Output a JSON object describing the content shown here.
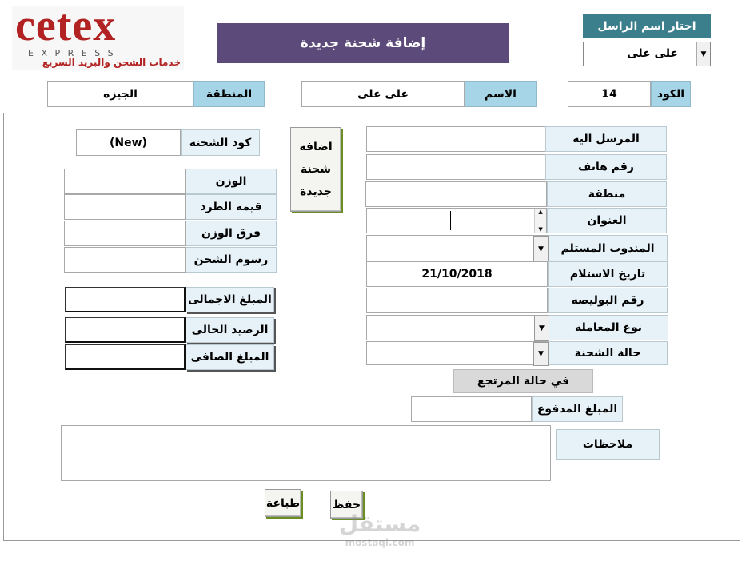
{
  "logo": {
    "brand": "cetex",
    "sub": "E X P R E S S",
    "tagline": "خدمات الشحن والبريد السريع"
  },
  "header": {
    "title": "إضافة شحنة جديدة"
  },
  "sender_select": {
    "label": "اختار اسم الراسل",
    "value": "على على"
  },
  "top_row": {
    "code_label": "الكود",
    "code_value": "14",
    "name_label": "الاسم",
    "name_value": "على على",
    "region_label": "المنطقة",
    "region_value": "الجيزه"
  },
  "form": {
    "recipient_label": "المرسل اليه",
    "phone_label": "رقم هاتف",
    "area_label": "منطقة",
    "address_label": "العنوان",
    "courier_label": "المندوب المستلم",
    "receive_date_label": "تاريخ الاستلام",
    "receive_date_value": "21/10/2018",
    "policy_label": "رقم البوليصه",
    "transaction_label": "نوع المعامله",
    "status_label": "حالة الشحنة",
    "return_label": "في حالة المرتجع",
    "paid_label": "المبلغ المدفوع",
    "notes_label": "ملاحظات"
  },
  "add_button": {
    "line1": "اضافه",
    "line2": "شحنة",
    "line3": "جديدة"
  },
  "shipment": {
    "code_label": "كود الشحنه",
    "code_value": "(New)",
    "weight_label": "الوزن",
    "parcel_value_label": "قيمة الطرد",
    "weight_diff_label": "فرق الوزن",
    "fees_label": "رسوم الشحن",
    "total_label": "المبلغ الاجمالى",
    "balance_label": "الرصيد الحالى",
    "net_label": "المبلغ الصافى"
  },
  "actions": {
    "save": "حفظ",
    "print": "طباعة"
  },
  "watermark": {
    "arabic": "مستقل",
    "latin": "mostaql.com"
  },
  "colors": {
    "title_bg": "#5c4a7a",
    "sender_label_bg": "#3b7f8c",
    "logo_red": "#b22222"
  }
}
